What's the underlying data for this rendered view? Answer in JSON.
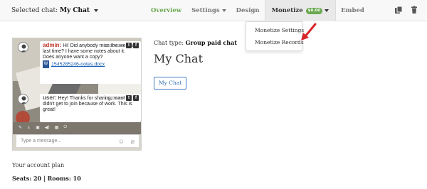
{
  "header": {
    "selected_chat_label": "Selected chat:",
    "selected_chat_name": "My Chat"
  },
  "nav": {
    "overview": "Overview",
    "settings": "Settings",
    "design": "Design",
    "monetize": "Monetize",
    "monetize_badge": "$0.00",
    "embed": "Embed"
  },
  "dropdown": {
    "items": [
      "Monetize Settings",
      "Monetize Records"
    ]
  },
  "preview": {
    "messages": [
      {
        "author": "admin:",
        "time": "12-20 13:48",
        "text": "Hi! Did anybody miss the webinar last time? I have some notes about it. Does anyone want a copy?",
        "attachment": "1545285246-notes.docx"
      },
      {
        "author": "user:",
        "time": "12-20 13:50",
        "text": "Hey! Thanks for sharing, man! I didn't get to join because of work. This is great!"
      }
    ],
    "input_placeholder": "Type a message..."
  },
  "chat": {
    "type_label": "Chat type:",
    "type_value": "Group paid chat",
    "title": "My Chat",
    "button_label": "My Chat"
  },
  "plan": {
    "label": "Your account plan",
    "seats_label": "Seats: 20",
    "separator": "|",
    "rooms_label": "Rooms: 10"
  },
  "colors": {
    "accent_green": "#6aa84f",
    "link_blue": "#2f6fb5",
    "annotation_red": "#d9262b"
  },
  "icons": [
    "copy-icon",
    "trash-icon",
    "chevron-down-icon",
    "red-arrow-icon"
  ]
}
